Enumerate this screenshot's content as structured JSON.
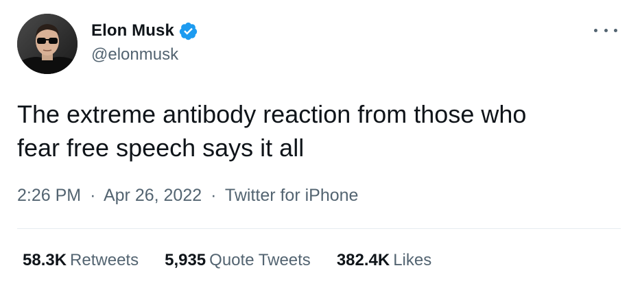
{
  "author": {
    "name": "Elon Musk",
    "handle": "@elonmusk",
    "verified_icon": "verified-badge-icon",
    "avatar_icon": "profile-photo"
  },
  "tweet": {
    "text_line1": "The extreme antibody reaction from those who",
    "text_line2": "fear free speech says it all"
  },
  "meta": {
    "time": "2:26 PM",
    "separator": "·",
    "date": "Apr 26, 2022",
    "source": "Twitter for iPhone"
  },
  "stats": {
    "retweets_count": "58.3K",
    "retweets_label": "Retweets",
    "quotes_count": "5,935",
    "quotes_label": "Quote Tweets",
    "likes_count": "382.4K",
    "likes_label": "Likes"
  },
  "colors": {
    "text_primary": "#0f1419",
    "text_secondary": "#536471",
    "verified_blue": "#1d9bf0",
    "divider": "#e6ecf0"
  }
}
